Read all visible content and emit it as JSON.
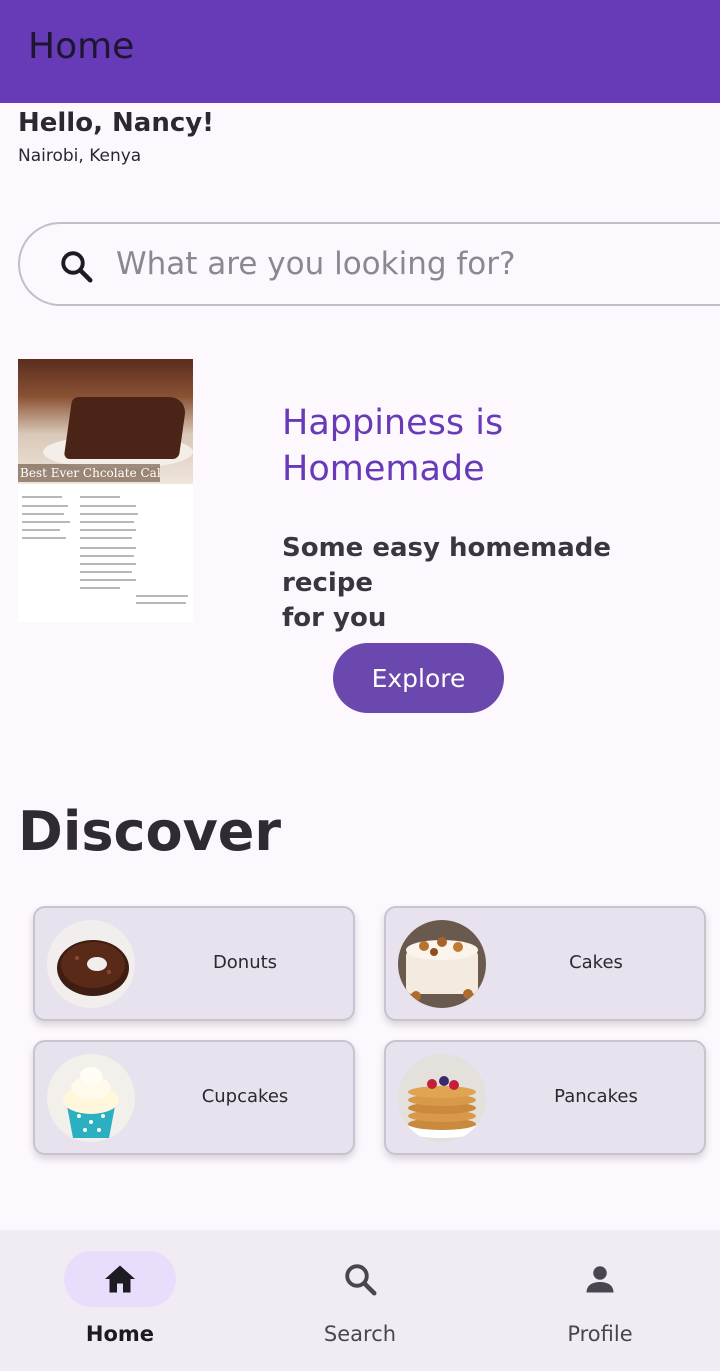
{
  "appbar": {
    "title": "Home"
  },
  "user": {
    "greeting": "Hello, Nancy!",
    "location": "Nairobi, Kenya"
  },
  "search": {
    "placeholder": "What are you looking for?"
  },
  "promo": {
    "image_caption": "Best Ever Chcolate Cake",
    "heading_line1": "Happiness is",
    "heading_line2": "Homemade",
    "subtitle_line1": "Some easy homemade recipe",
    "subtitle_line2": "for you",
    "button": "Explore"
  },
  "discover": {
    "title": "Discover",
    "categories": [
      {
        "label": "Donuts",
        "icon": "donut-image"
      },
      {
        "label": "Cakes",
        "icon": "cake-image"
      },
      {
        "label": "Cupcakes",
        "icon": "cupcake-image"
      },
      {
        "label": "Pancakes",
        "icon": "pancake-image"
      }
    ]
  },
  "bottom_nav": {
    "items": [
      {
        "label": "Home",
        "icon": "home-icon",
        "active": true
      },
      {
        "label": "Search",
        "icon": "search-icon",
        "active": false
      },
      {
        "label": "Profile",
        "icon": "person-icon",
        "active": false
      }
    ]
  },
  "colors": {
    "primary": "#673ab7",
    "button": "#6a48ad",
    "card": "#e8e2ee",
    "background": "#fdf8fd",
    "nav_active_pill": "#e8ddfb"
  }
}
